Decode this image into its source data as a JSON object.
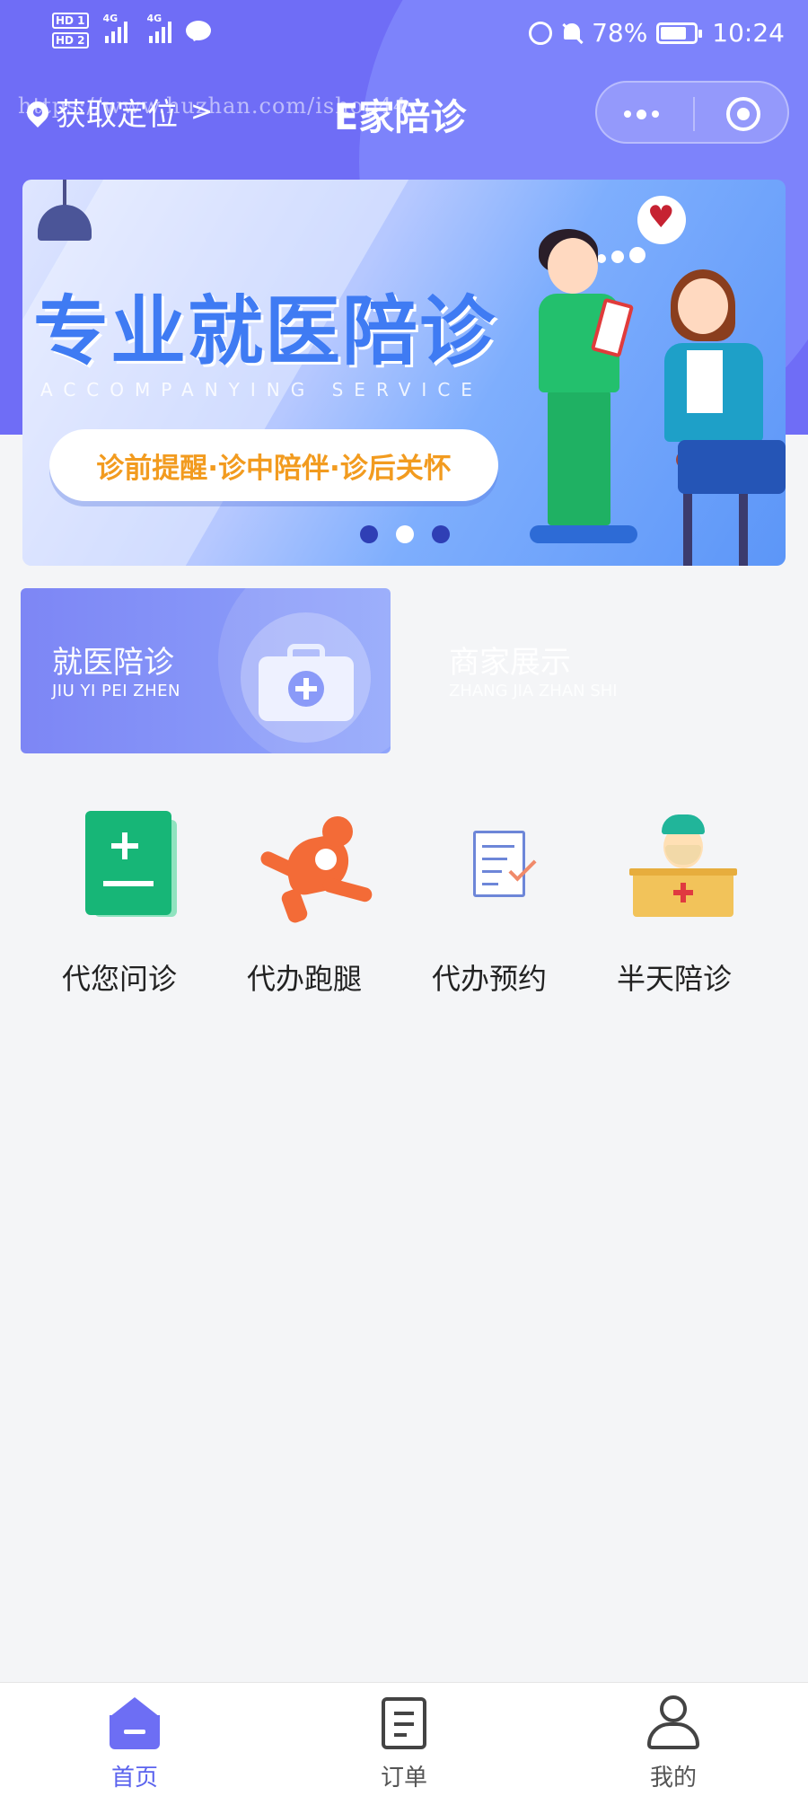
{
  "status_bar": {
    "sim1": "HD 1",
    "sim2": "HD 2",
    "net1": "4G",
    "net2": "4G",
    "battery": "78%",
    "battery_level": 0.78,
    "time": "10:24"
  },
  "nav": {
    "location_label": "获取定位",
    "location_chevron": ">",
    "title": "E家陪诊",
    "watermark": "https://www.huzhan.com/ishop44"
  },
  "banner": {
    "title": "专业就医陪诊",
    "subtitle": "ACCOMPANYING SERVICE",
    "pill": "诊前提醒·诊中陪伴·诊后关怀",
    "dot_count": 3,
    "active_dot": 1
  },
  "categories": [
    {
      "title": "就医陪诊",
      "en": "JIU YI PEI ZHEN"
    },
    {
      "title": "商家展示",
      "en": "ZHANG JIA ZHAN SHI"
    }
  ],
  "services": [
    {
      "label": "代您问诊",
      "icon": "consult-icon"
    },
    {
      "label": "代办跑腿",
      "icon": "runner-icon"
    },
    {
      "label": "代办预约",
      "icon": "appointment-icon"
    },
    {
      "label": "半天陪诊",
      "icon": "doctor-icon"
    }
  ],
  "tabbar": [
    {
      "label": "首页",
      "icon": "home-icon",
      "active": true
    },
    {
      "label": "订单",
      "icon": "order-icon",
      "active": false
    },
    {
      "label": "我的",
      "icon": "profile-icon",
      "active": false
    }
  ],
  "colors": {
    "primary": "#6f6df6",
    "active_tab": "#5b63ee",
    "background": "#f4f5f7"
  }
}
